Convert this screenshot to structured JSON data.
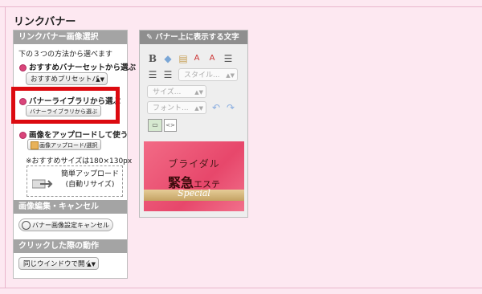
{
  "page_title": "リンクバナー",
  "left": {
    "section1_title": "リンクバナー画像選択",
    "intro": "下の３つの方法から選べます",
    "opt1_label": "おすすめバナーセットから選ぶ",
    "opt1_select": "おすすめプリセットパ",
    "opt2_label": "バナーライブラリから選ぶ",
    "opt2_button": "バナーライブラリから選ぶ",
    "opt3_label": "画像をアップロードして使う",
    "upload_button": "画像アップロード/選択",
    "size_note": "※おすすめサイズは180×130px",
    "dropzone_line1": "簡単アップロード",
    "dropzone_line2": "(自動リサイズ)",
    "section2_title": "画像編集・キャンセル",
    "cancel_button": "バナー画像設定キャンセル",
    "section3_title": "クリックした際の動作",
    "click_action": "同じウインドウで開く"
  },
  "right": {
    "title": "バナー上に表示する文字",
    "style_placeholder": "スタイル...",
    "size_placeholder": "サイズ...",
    "font_placeholder": "フォント..."
  },
  "banner": {
    "line1": "ブライダル",
    "line2_main": "緊急",
    "line2_small": "エステ",
    "ribbon": "Special"
  },
  "colors": {
    "accent_pink": "#d9457a",
    "highlight_red": "#dc0a10",
    "background": "#fde8f1"
  }
}
